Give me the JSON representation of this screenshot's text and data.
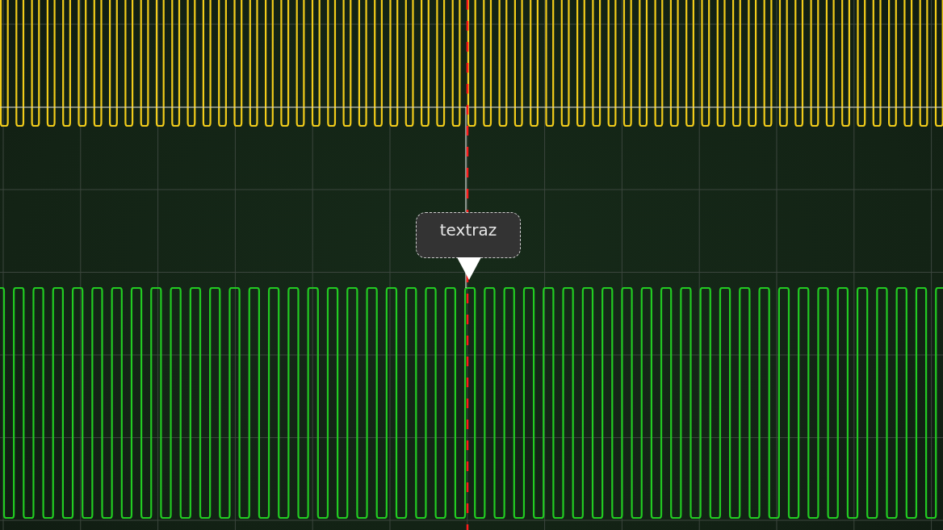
{
  "cursor": {
    "label": "textraz"
  }
}
